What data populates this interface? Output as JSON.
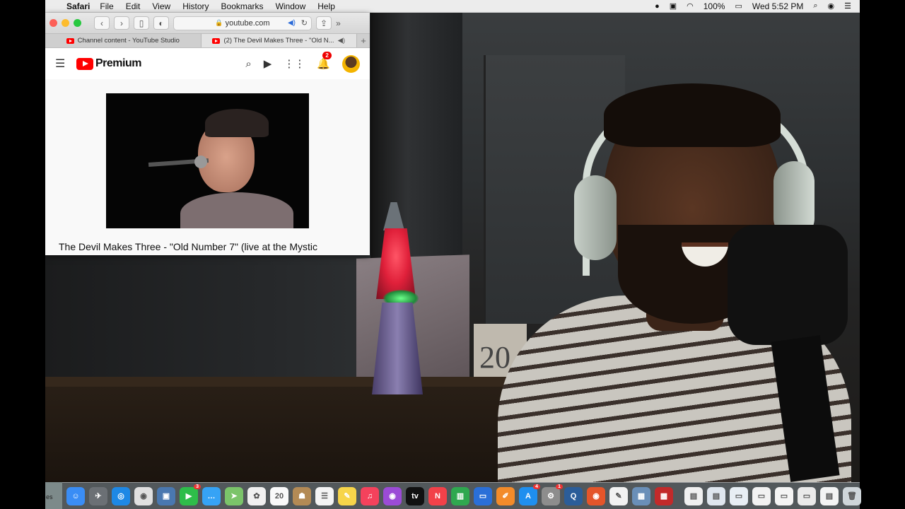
{
  "menubar": {
    "apple": "",
    "app_name": "Safari",
    "items": [
      "File",
      "Edit",
      "View",
      "History",
      "Bookmarks",
      "Window",
      "Help"
    ],
    "battery": "100%",
    "clock": "Wed 5:52 PM"
  },
  "safari": {
    "url": "youtube.com",
    "tabs": [
      {
        "label": "Channel content - YouTube Studio"
      },
      {
        "label": "(2) The Devil Makes Three - \"Old N..."
      }
    ],
    "new_tab": "+"
  },
  "youtube": {
    "logo_text": "Premium",
    "notifications_count": "2",
    "video_title": "The Devil Makes Three - \"Old Number 7\" (live at the Mystic"
  },
  "scene": {
    "calendar_number": "20"
  },
  "dock": {
    "edge_text": "es",
    "icons": [
      {
        "name": "finder",
        "color": "#3a8df5",
        "glyph": "☺"
      },
      {
        "name": "launchpad",
        "color": "#6b7075",
        "glyph": "✈"
      },
      {
        "name": "safari",
        "color": "#1e88e5",
        "glyph": "◎"
      },
      {
        "name": "chrome",
        "color": "#e0e0e0",
        "glyph": "◉"
      },
      {
        "name": "preview",
        "color": "#4a78b0",
        "glyph": "▣"
      },
      {
        "name": "facetime",
        "color": "#2ebd4a",
        "glyph": "▶",
        "badge": "3"
      },
      {
        "name": "messages",
        "color": "#36a3f5",
        "glyph": "…"
      },
      {
        "name": "maps",
        "color": "#7bc46a",
        "glyph": "➤"
      },
      {
        "name": "photos",
        "color": "#f0f0f0",
        "glyph": "✿"
      },
      {
        "name": "calendar",
        "color": "#fafafa",
        "glyph": "20"
      },
      {
        "name": "contacts",
        "color": "#b38a55",
        "glyph": "☗"
      },
      {
        "name": "reminders",
        "color": "#f4f4f4",
        "glyph": "☰"
      },
      {
        "name": "notes",
        "color": "#f7d54a",
        "glyph": "✎"
      },
      {
        "name": "music",
        "color": "#f4425c",
        "glyph": "♫"
      },
      {
        "name": "podcasts",
        "color": "#9b4bd6",
        "glyph": "◉"
      },
      {
        "name": "tv",
        "color": "#111111",
        "glyph": "tv"
      },
      {
        "name": "news",
        "color": "#f24149",
        "glyph": "N"
      },
      {
        "name": "numbers",
        "color": "#2fa84f",
        "glyph": "▥"
      },
      {
        "name": "keynote",
        "color": "#2a6fd8",
        "glyph": "▭"
      },
      {
        "name": "pages",
        "color": "#f38b2a",
        "glyph": "✐"
      },
      {
        "name": "app-store",
        "color": "#1f8fef",
        "glyph": "A",
        "badge": "4"
      },
      {
        "name": "system-preferences",
        "color": "#8d8d8d",
        "glyph": "⚙",
        "badge": "1"
      },
      {
        "name": "quicktime",
        "color": "#2b5d99",
        "glyph": "Q"
      },
      {
        "name": "photo-booth",
        "color": "#e4552a",
        "glyph": "◉"
      },
      {
        "name": "textedit",
        "color": "#f2f2f2",
        "glyph": "✎"
      },
      {
        "name": "image-capture",
        "color": "#6a8fb8",
        "glyph": "▦"
      },
      {
        "name": "photo-booth-2",
        "color": "#c22a2a",
        "glyph": "▩"
      },
      {
        "name": "document-1",
        "color": "#f0f0f0",
        "glyph": "▤"
      },
      {
        "name": "document-2",
        "color": "#dfe6ee",
        "glyph": "▤"
      },
      {
        "name": "document-3",
        "color": "#e8eef4",
        "glyph": "▭"
      },
      {
        "name": "document-4",
        "color": "#f2f2f2",
        "glyph": "▭"
      },
      {
        "name": "document-5",
        "color": "#f4f4f4",
        "glyph": "▭"
      },
      {
        "name": "document-6",
        "color": "#eaeaea",
        "glyph": "▭"
      },
      {
        "name": "document-7",
        "color": "#f4f4f4",
        "glyph": "▤"
      },
      {
        "name": "trash",
        "color": "#cfd6da",
        "glyph": "🗑"
      }
    ]
  }
}
